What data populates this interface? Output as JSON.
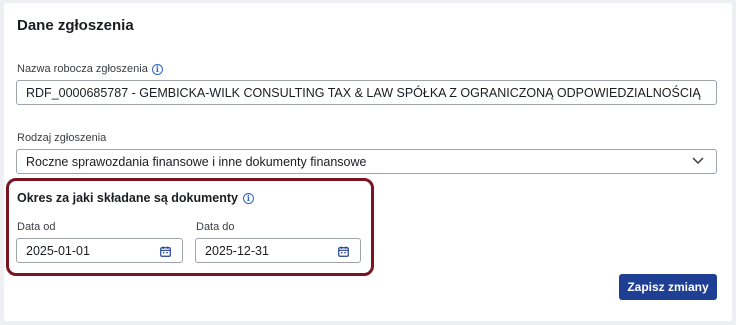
{
  "card": {
    "title": "Dane zgłoszenia"
  },
  "working_name": {
    "label": "Nazwa robocza zgłoszenia",
    "value": "RDF_0000685787 - GEMBICKA-WILK CONSULTING TAX & LAW SPÓŁKA Z OGRANICZONĄ ODPOWIEDZIALNOŚCIĄ"
  },
  "submission_type": {
    "label": "Rodzaj zgłoszenia",
    "selected": "Roczne sprawozdania finansowe i inne dokumenty finansowe"
  },
  "period": {
    "title": "Okres za jaki składane są dokumenty",
    "date_from_label": "Data od",
    "date_from_value": "2025-01-01",
    "date_to_label": "Data do",
    "date_to_value": "2025-12-31"
  },
  "actions": {
    "save_label": "Zapisz zmiany"
  },
  "colors": {
    "primary_button": "#1e3f94",
    "highlight_border": "#7a1420",
    "info_icon": "#2b63c9"
  },
  "icons": [
    "info-icon",
    "chevron-down-icon",
    "calendar-icon"
  ]
}
